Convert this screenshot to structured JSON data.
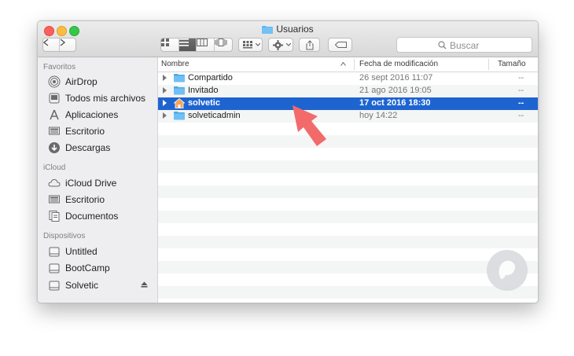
{
  "window": {
    "title": "Usuarios"
  },
  "toolbar": {
    "search_placeholder": "Buscar",
    "icons": [
      "chevron-left-icon",
      "chevron-right-icon",
      "icon-view-icon",
      "list-view-icon",
      "column-view-icon",
      "cover-flow-icon",
      "arrange-icon",
      "gear-icon",
      "share-icon",
      "tag-icon",
      "search-icon"
    ]
  },
  "sidebar": {
    "sections": [
      {
        "title": "Favoritos",
        "items": [
          {
            "label": "AirDrop",
            "icon": "airdrop-icon"
          },
          {
            "label": "Todos mis archivos",
            "icon": "all-files-icon"
          },
          {
            "label": "Aplicaciones",
            "icon": "applications-icon"
          },
          {
            "label": "Escritorio",
            "icon": "desktop-icon"
          },
          {
            "label": "Descargas",
            "icon": "downloads-icon"
          }
        ]
      },
      {
        "title": "iCloud",
        "items": [
          {
            "label": "iCloud Drive",
            "icon": "cloud-icon"
          },
          {
            "label": "Escritorio",
            "icon": "desktop-icon"
          },
          {
            "label": "Documentos",
            "icon": "documents-icon"
          }
        ]
      },
      {
        "title": "Dispositivos",
        "items": [
          {
            "label": "Untitled",
            "icon": "disk-icon"
          },
          {
            "label": "BootCamp",
            "icon": "disk-icon"
          },
          {
            "label": "Solvetic",
            "icon": "disk-icon"
          }
        ]
      }
    ]
  },
  "columns": {
    "name": "Nombre",
    "modified": "Fecha de modificación",
    "size": "Tamaño"
  },
  "rows": [
    {
      "name": "Compartido",
      "modified": "26 sept 2016 11:07",
      "size": "--",
      "selected": false,
      "icon": "folder-icon"
    },
    {
      "name": "Invitado",
      "modified": "21 ago 2016 19:05",
      "size": "--",
      "selected": false,
      "icon": "folder-icon"
    },
    {
      "name": "solvetic",
      "modified": "17 oct 2016 18:30",
      "size": "--",
      "selected": true,
      "icon": "home-folder-icon"
    },
    {
      "name": "solveticadmin",
      "modified": "hoy 14:22",
      "size": "--",
      "selected": false,
      "icon": "folder-icon"
    }
  ],
  "colors": {
    "selection": "#1e64d1",
    "folder": "#5db4f0",
    "annotation_arrow": "#f26a6a"
  }
}
